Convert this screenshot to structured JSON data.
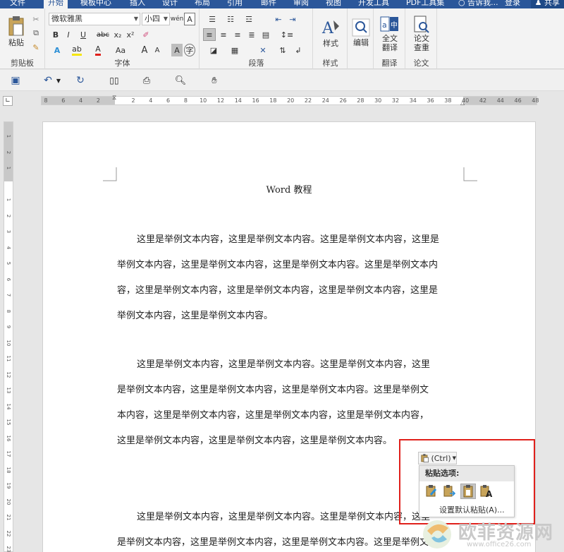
{
  "tabs": [
    "文件",
    "开始",
    "模板中心",
    "插入",
    "设计",
    "布局",
    "引用",
    "邮件",
    "审阅",
    "视图",
    "开发工具",
    "PDF工具集"
  ],
  "active_tab": "开始",
  "tell_me": "告诉我...",
  "login": "登录",
  "share": "共享",
  "ribbon": {
    "clipboard": {
      "paste": "粘贴",
      "label": "剪贴板"
    },
    "font": {
      "name": "微软雅黑",
      "size": "小四",
      "label": "字体",
      "buttons": [
        "B",
        "I",
        "U",
        "abc",
        "x₂",
        "x²",
        "A",
        "Aa",
        "A",
        "A",
        "A",
        "字"
      ]
    },
    "paragraph": {
      "label": "段落"
    },
    "styles": {
      "button": "样式",
      "label": "样式"
    },
    "editing": {
      "button": "编辑"
    },
    "translate": {
      "button_line1": "全文",
      "button_line2": "翻译",
      "label": "翻译"
    },
    "paper": {
      "button_line1": "论文",
      "button_line2": "查重",
      "label": "论文"
    }
  },
  "ruler": {
    "labels": [
      "8",
      "6",
      "4",
      "2",
      "",
      "2",
      "4",
      "6",
      "8",
      "10",
      "12",
      "14",
      "16",
      "18",
      "20",
      "22",
      "24",
      "26",
      "28",
      "30",
      "32",
      "34",
      "36",
      "38",
      "40",
      "42",
      "44",
      "46",
      "48"
    ],
    "vlabels": [
      "1",
      "2",
      "1",
      "",
      "1",
      "2",
      "3",
      "4",
      "5",
      "6",
      "7",
      "8",
      "9",
      "10",
      "11",
      "12",
      "13",
      "14",
      "15",
      "16",
      "17",
      "18",
      "19",
      "20",
      "21",
      "22",
      "23",
      "24"
    ]
  },
  "document": {
    "title": "Word 教程",
    "paragraphs": [
      [
        "这里是举例文本内容，这里是举例文本内容。这里是举例文本内容，这里是",
        "举例文本内容，这里是举例文本内容，这里是举例文本内容。这里是举例文本内",
        "容，这里是举例文本内容，这里是举例文本内容，这里是举例文本内容，这里是",
        "举例文本内容，这里是举例文本内容。"
      ],
      [
        "这里是举例文本内容，这里是举例文本内容。这里是举例文本内容，这里",
        "是举例文本内容，这里是举例文本内容，这里是举例文本内容。这里是举例文",
        "本内容，这里是举例文本内容，这里是举例文本内容，这里是举例文本内容，",
        "这里是举例文本内容，这里是举例文本内容，这里是举例文本内容。"
      ],
      [
        "这里是举例文本内容，这里是举例文本内容。这里是举例文本内容，这里",
        "是举例文本内容，这里是举例文本内容，这里是举例文本内容。这里是举例文"
      ]
    ]
  },
  "paste_options": {
    "button": "(Ctrl)",
    "header": "粘贴选项:",
    "set_default": "设置默认粘贴(A)..."
  },
  "watermark": {
    "text": "欧菲资源网",
    "url": "www.office26.com"
  },
  "colors": {
    "accent": "#2b579a",
    "highlight_box": "#e0201b"
  }
}
